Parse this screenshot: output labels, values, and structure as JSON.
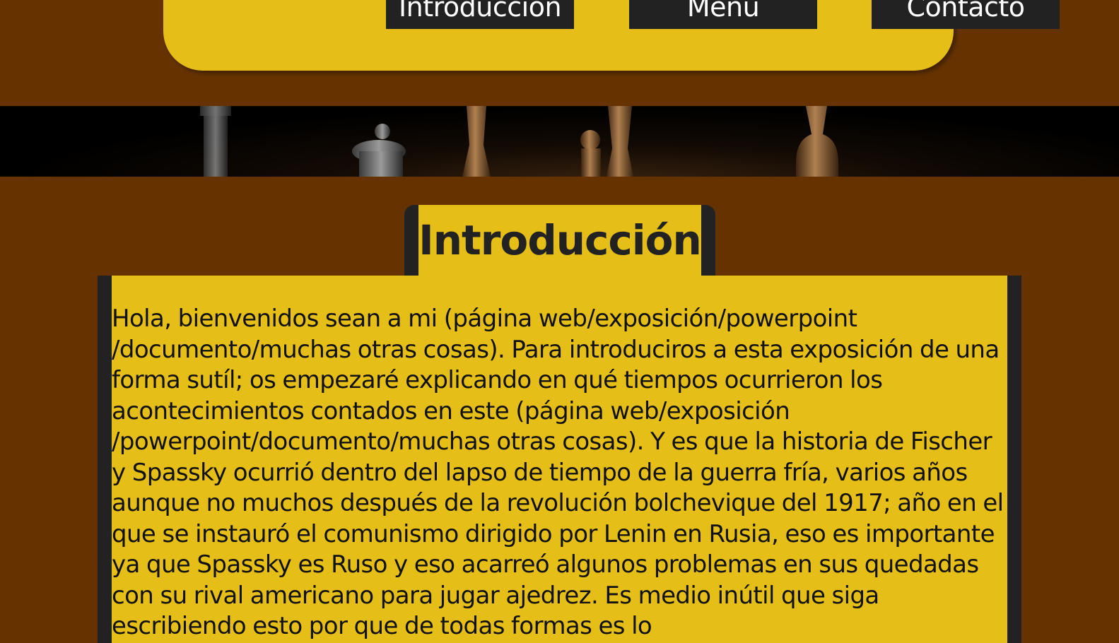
{
  "nav": {
    "items": [
      {
        "label": "Introducción"
      },
      {
        "label": "Menú"
      },
      {
        "label": "Contacto"
      }
    ]
  },
  "banner": {
    "icon": "chess-pieces-photo"
  },
  "section": {
    "title": "Introducción",
    "paragraph": "Hola, bienvenidos sean a mi (página web/exposición/powerpoint /documento/muchas otras cosas). Para introduciros a esta exposición de una forma sutíl; os empezaré explicando en qué tiempos ocurrieron los acontecimientos contados en este (página web/exposición /powerpoint/documento/muchas otras cosas). Y es que la historia de Fischer y Spassky ocurrió dentro del lapso de tiempo de la guerra fría, varios años aunque no muchos después de la revolución bolchevique del 1917; año en el que se instauró el comunismo dirigido por Lenin en Rusia, eso es importante ya que Spassky es Ruso y eso acarreó algunos problemas en sus quedadas con su rival americano para jugar ajedrez. Es medio inútil que siga escribiendo esto por que de todas formas es lo"
  },
  "colors": {
    "background": "#663300",
    "accent": "#e5be17",
    "dark": "#222222"
  }
}
